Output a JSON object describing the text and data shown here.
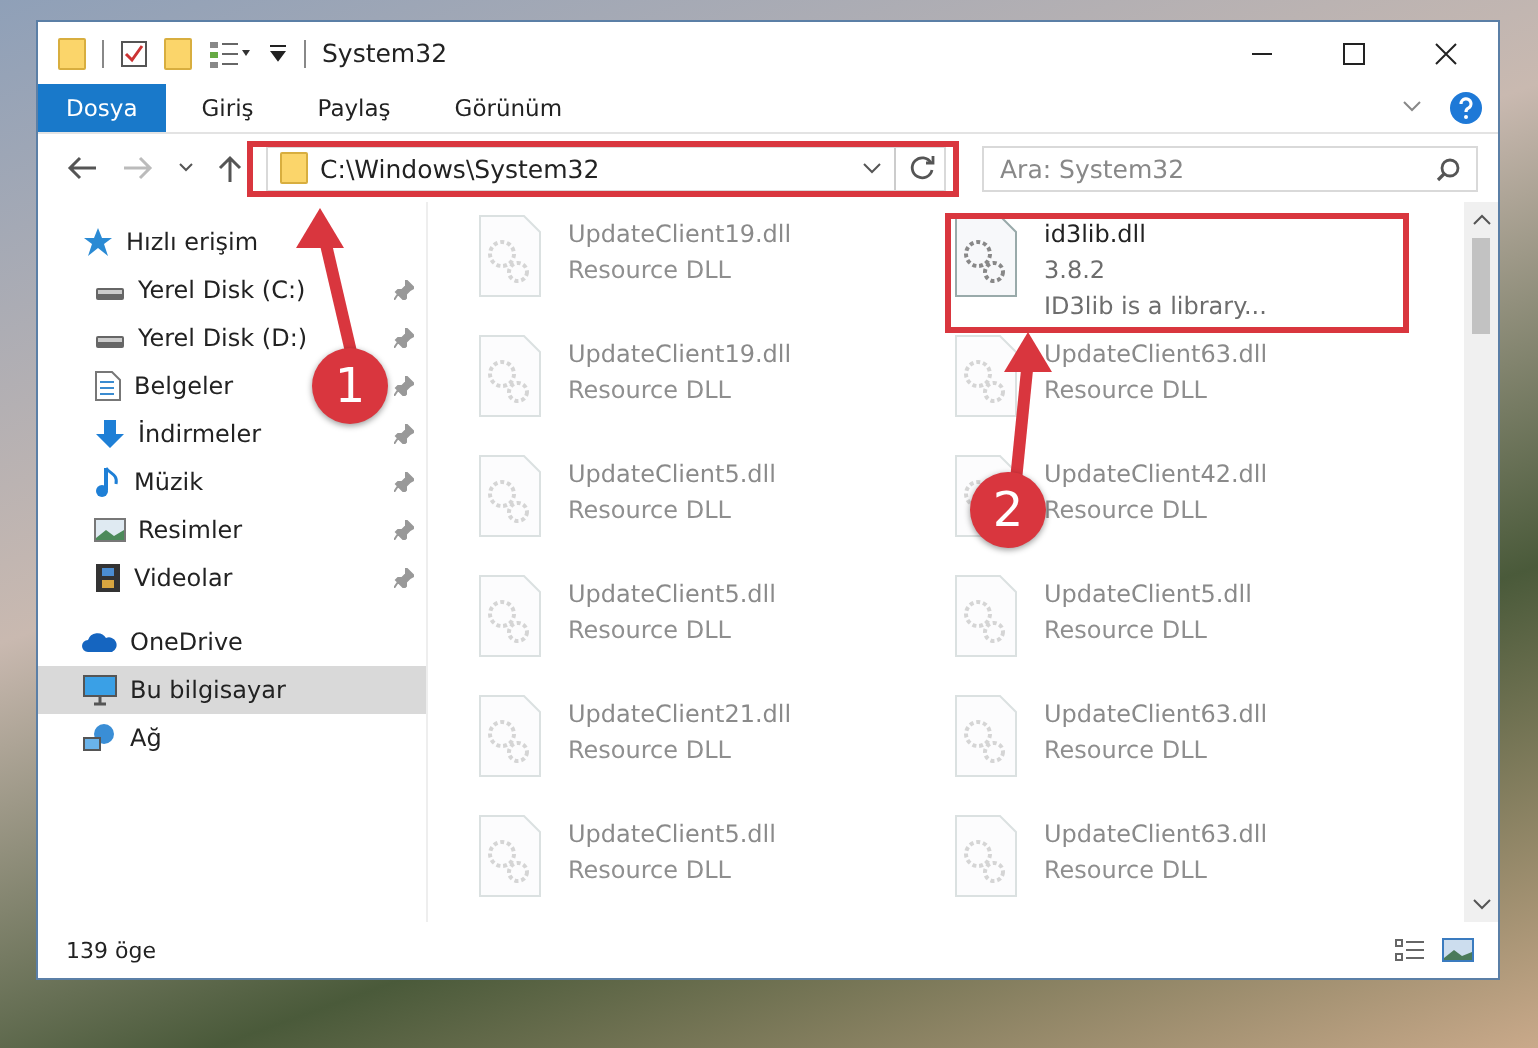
{
  "window": {
    "title": "System32"
  },
  "ribbon_tabs": [
    {
      "label": "Dosya",
      "selected": true
    },
    {
      "label": "Giriş",
      "selected": false
    },
    {
      "label": "Paylaş",
      "selected": false
    },
    {
      "label": "Görünüm",
      "selected": false
    }
  ],
  "address_bar": {
    "value": "C:\\Windows\\System32"
  },
  "search": {
    "placeholder": "Ara: System32"
  },
  "sidebar": {
    "items": [
      {
        "label": "Hızlı erişim",
        "selected": false,
        "children": [
          {
            "label": "Yerel Disk (C:)",
            "pinned": true
          },
          {
            "label": "Yerel Disk (D:)",
            "pinned": true
          },
          {
            "label": "Belgeler",
            "pinned": true
          },
          {
            "label": "İndirmeler",
            "pinned": true
          },
          {
            "label": "Müzik",
            "pinned": true
          },
          {
            "label": "Resimler",
            "pinned": true
          },
          {
            "label": "Videolar",
            "pinned": true
          }
        ]
      },
      {
        "label": "OneDrive",
        "selected": false
      },
      {
        "label": "Bu bilgisayar",
        "selected": true
      },
      {
        "label": "Ağ",
        "selected": false
      }
    ]
  },
  "files": [
    {
      "name": "UpdateClient19.dll",
      "lines": [
        "Resource DLL"
      ],
      "kind": "faded"
    },
    {
      "name": "id3lib.dll",
      "lines": [
        "3.8.2",
        "ID3lib is a library..."
      ],
      "kind": "focus"
    },
    {
      "name": "UpdateClient19.dll",
      "lines": [
        "Resource DLL"
      ],
      "kind": "faded"
    },
    {
      "name": "UpdateClient63.dll",
      "lines": [
        "Resource DLL"
      ],
      "kind": "faded"
    },
    {
      "name": "UpdateClient5.dll",
      "lines": [
        "Resource DLL"
      ],
      "kind": "faded"
    },
    {
      "name": "UpdateClient42.dll",
      "lines": [
        "Resource DLL"
      ],
      "kind": "faded"
    },
    {
      "name": "UpdateClient5.dll",
      "lines": [
        "Resource DLL"
      ],
      "kind": "faded"
    },
    {
      "name": "UpdateClient5.dll",
      "lines": [
        "Resource DLL"
      ],
      "kind": "faded"
    },
    {
      "name": "UpdateClient21.dll",
      "lines": [
        "Resource DLL"
      ],
      "kind": "faded"
    },
    {
      "name": "UpdateClient63.dll",
      "lines": [
        "Resource DLL"
      ],
      "kind": "faded"
    },
    {
      "name": "UpdateClient5.dll",
      "lines": [
        "Resource DLL"
      ],
      "kind": "faded"
    },
    {
      "name": "UpdateClient63.dll",
      "lines": [
        "Resource DLL"
      ],
      "kind": "faded"
    }
  ],
  "status_bar": {
    "item_count": "139 öge"
  },
  "annotations": [
    {
      "number": "1"
    },
    {
      "number": "2"
    }
  ]
}
